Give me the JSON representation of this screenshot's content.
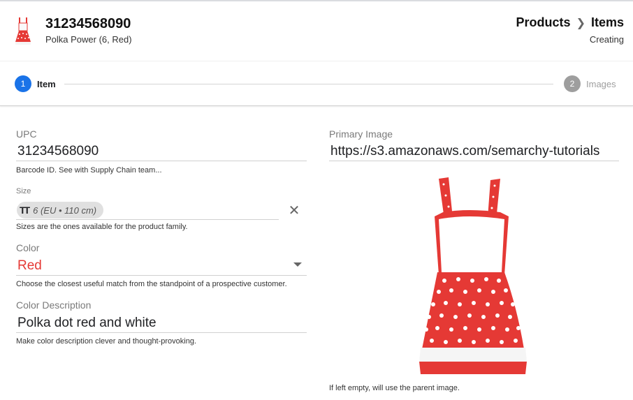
{
  "header": {
    "title": "31234568090",
    "subtitle": "Polka Power (6, Red)",
    "breadcrumb": [
      "Products",
      "Items"
    ],
    "status": "Creating"
  },
  "stepper": {
    "steps": [
      {
        "number": "1",
        "label": "Item",
        "active": true
      },
      {
        "number": "2",
        "label": "Images",
        "active": false
      }
    ]
  },
  "form": {
    "upc": {
      "label": "UPC",
      "value": "31234568090",
      "hint": "Barcode ID. See with Supply Chain team..."
    },
    "size": {
      "label": "Size",
      "chip": "6 (EU • 110 cm)",
      "chip_icon": "text-size-icon",
      "hint": "Sizes are the ones available for the product family."
    },
    "color": {
      "label": "Color",
      "value": "Red",
      "value_color": "#e53935",
      "hint": "Choose the closest useful match from the standpoint of a prospective customer."
    },
    "color_description": {
      "label": "Color Description",
      "value": "Polka dot red and white",
      "hint": "Make color description clever and thought-provoking."
    },
    "primary_image": {
      "label": "Primary Image",
      "value": "https://s3.amazonaws.com/semarchy-tutorials",
      "hint": "If left empty, will use the parent image."
    }
  },
  "colors": {
    "accent": "#1a73e8",
    "inactive_step": "#9e9e9e",
    "dress_red": "#e53935"
  }
}
